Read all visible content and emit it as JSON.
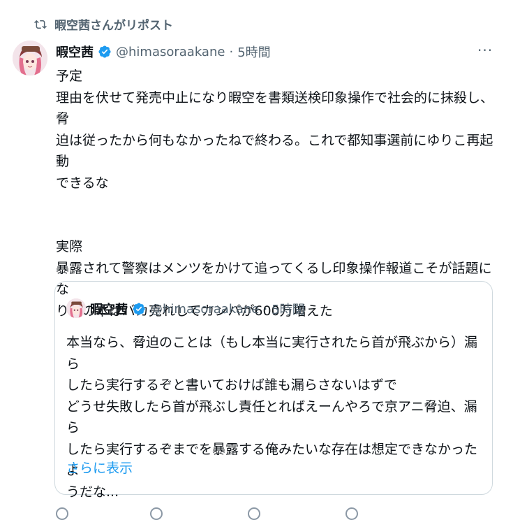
{
  "repost": {
    "label": "暇空茜さんがリポスト"
  },
  "tweet": {
    "name": "暇空茜",
    "handle": "@himasoraakane",
    "separator": "·",
    "time": "5時間",
    "lines": [
      "予定",
      "理由を伏せて発売中止になり暇空を書類送検印象操作で社会的に抹殺し、脅",
      "迫は従ったから何もなかったねで終わる。これで都知事選前にゆりこ再起動",
      "できるな",
      "",
      "実際",
      "暴露されて警察はメンツをかけて追ってくるし印象操作報道こそが話題にな",
      "り俺の本はバカ売れしてカンパが600万増えた"
    ]
  },
  "quote": {
    "name": "暇空茜",
    "handle": "@himasoraakane",
    "separator": "·",
    "time": "5時間",
    "lines": [
      "本当なら、脅迫のことは（もし本当に実行されたら首が飛ぶから）漏ら",
      "したら実行するぞと書いておけば誰も漏らさないはずで",
      "どうせ失敗したら首が飛ぶし責任とればえーんやろで京アニ脅迫、漏ら",
      "したら実行するぞまでを暴露する俺みたいな存在は想定できなかったよ",
      "うだな..."
    ],
    "show_more": "さらに表示"
  },
  "colors": {
    "text": "#0f1419",
    "secondary": "#536471",
    "link": "#1d9bf0",
    "verified": "#1d9bf0",
    "border": "#cfd9de"
  },
  "icons": {
    "repost": "repost-icon",
    "verified": "verified-badge-icon",
    "more": "more-icon"
  }
}
